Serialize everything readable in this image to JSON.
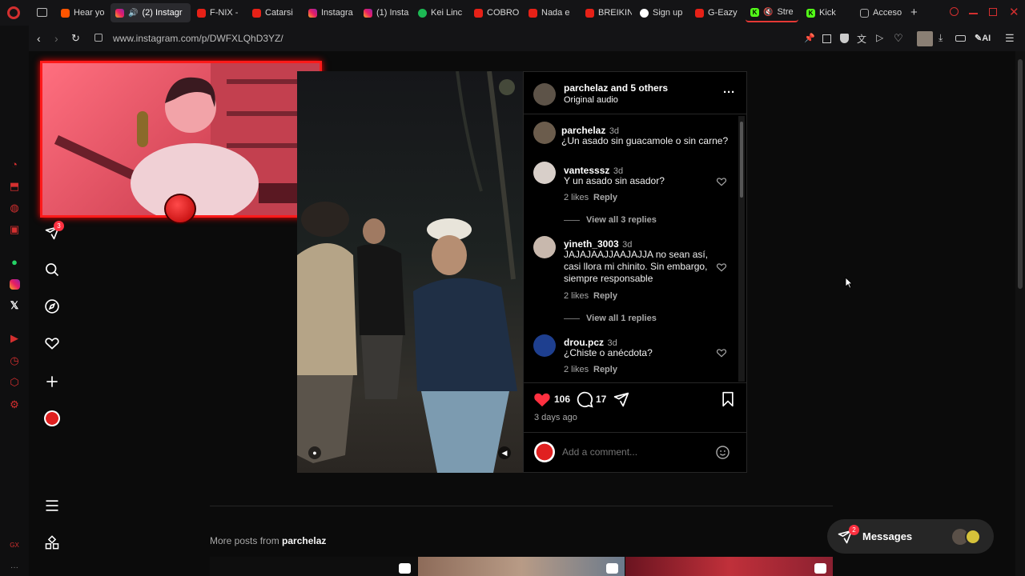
{
  "browser": {
    "tabs": [
      {
        "label": "Hear yo",
        "icon": "soundcloud-icon"
      },
      {
        "label": "(2) Instagr",
        "icon": "instagram-icon",
        "active": true
      },
      {
        "label": "F-NIX -",
        "icon": "youtube-icon"
      },
      {
        "label": "Catarsi",
        "icon": "youtube-icon"
      },
      {
        "label": "Instagra",
        "icon": "instagram-icon"
      },
      {
        "label": "(1) Insta",
        "icon": "instagram-icon"
      },
      {
        "label": "Kei Linc",
        "icon": "spotify-icon"
      },
      {
        "label": "COBRO",
        "icon": "youtube-icon"
      },
      {
        "label": "Nada e",
        "icon": "youtube-icon"
      },
      {
        "label": "BREIKIN",
        "icon": "youtube-icon"
      },
      {
        "label": "Sign up",
        "icon": "spotify-icon"
      },
      {
        "label": "G-Eazy",
        "icon": "youtube-icon"
      },
      {
        "label": "Stre",
        "icon": "kick-icon"
      },
      {
        "label": "Kick",
        "icon": "kick-icon"
      },
      {
        "label": "Acceso",
        "icon": "grid-icon"
      }
    ],
    "url": "www.instagram.com/p/DWFXLQhD3YZ/",
    "ai_label": "AI"
  },
  "nav": {
    "notification_badge": "3"
  },
  "post": {
    "header_user": "parchelaz",
    "header_others": "and 5 others",
    "audio": "Original audio",
    "comments": [
      {
        "user": "parchelaz",
        "time": "3d",
        "text": "¿Un asado sin guacamole o sin carne?"
      },
      {
        "user": "vantesssz",
        "time": "3d",
        "text": "Y un asado sin asador?",
        "likes": "2 likes",
        "reply": "Reply",
        "view_replies": "View all 3 replies"
      },
      {
        "user": "yineth_3003",
        "time": "3d",
        "text": "JAJAJAAJJAAJAJJA no sean así, casi llora mi chinito. Sin embargo, siempre responsable",
        "likes": "2 likes",
        "reply": "Reply",
        "view_replies": "View all 1 replies"
      },
      {
        "user": "drou.pcz",
        "time": "3d",
        "text": "¿Chiste o anécdota?",
        "likes": "2 likes",
        "reply": "Reply"
      }
    ],
    "like_count": "106",
    "comment_count": "17",
    "posted": "3 days ago",
    "add_comment_placeholder": "Add a comment...",
    "colors": {
      "like": "#ff3040",
      "accent": "#ff1a1a"
    }
  },
  "more_posts": {
    "prefix": "More posts from",
    "user": "parchelaz"
  },
  "messages": {
    "label": "Messages",
    "badge": "2"
  }
}
